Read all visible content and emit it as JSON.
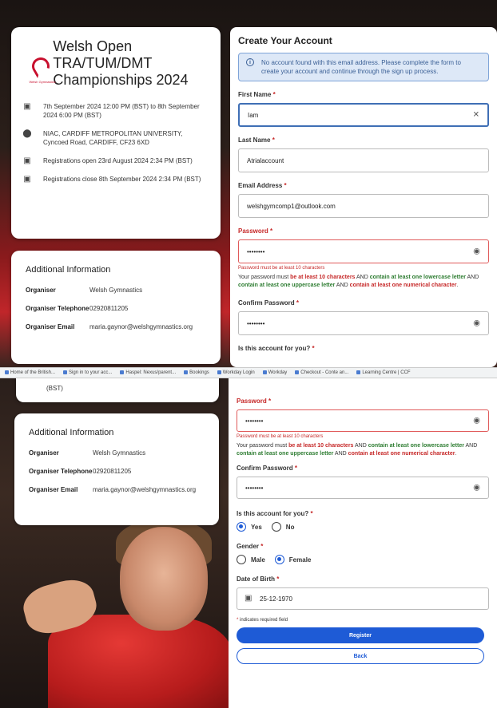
{
  "event": {
    "title": "Welsh Open TRA/TUM/DMT Championships 2024",
    "logo_text": "Welsh Gymnastics",
    "datetime": "7th September 2024 12:00 PM (BST) to 8th September 2024 6:00 PM (BST)",
    "venue": "NIAC, CARDIFF METROPOLITAN UNIVERSITY, Cyncoed Road, CARDIFF, CF23 6XD",
    "reg_open": "Registrations open 23rd August 2024 2:34 PM (BST)",
    "reg_close": "Registrations close 8th September 2024 2:34 PM (BST)",
    "reg_close_tail": "(BST)"
  },
  "additional": {
    "heading": "Additional Information",
    "rows": [
      {
        "key": "Organiser",
        "value": "Welsh Gymnastics"
      },
      {
        "key": "Organiser Telephone",
        "value": "02920811205"
      },
      {
        "key": "Organiser Email",
        "value": "maria.gaynor@welshgymnastics.org"
      }
    ]
  },
  "browser": {
    "bookmarks": [
      "Home of the British...",
      "Sign in to your acc...",
      "Haspel: Nexus/parent...",
      "Bookings",
      "Workday Login",
      "Workday",
      "Checkout - Conte an...",
      "Learning Centre | CCF"
    ]
  },
  "form": {
    "title": "Create Your Account",
    "alert": "No account found with this email address. Please complete the form to create your account and continue through the sign up process.",
    "first_name": {
      "label": "First Name",
      "value": "Iam"
    },
    "last_name": {
      "label": "Last Name",
      "value": "Atrialaccount"
    },
    "email": {
      "label": "Email Address",
      "value": "welshgymcomp1@outlook.com"
    },
    "password": {
      "label": "Password",
      "value": "••••••••",
      "error": "Password must be at least 10 characters"
    },
    "password_hint": {
      "p1": "Your password must ",
      "r1": "be at least 10 characters",
      "p2": " AND ",
      "g1": "contain at least one lowercase letter",
      "p3": " AND ",
      "g2": "contain at least one uppercase letter",
      "p4": " AND ",
      "r2": "contain at least one numerical character",
      "p5": "."
    },
    "confirm_password": {
      "label": "Confirm Password",
      "value": "••••••••"
    },
    "for_you": {
      "label": "Is this account for you?",
      "yes": "Yes",
      "no": "No",
      "selected": "Yes"
    },
    "gender": {
      "label": "Gender",
      "male": "Male",
      "female": "Female",
      "selected": "Female"
    },
    "dob": {
      "label": "Date of Birth",
      "value": "25-12-1970"
    },
    "required_note": "indicates required field",
    "required_mark": "*",
    "register_label": "Register",
    "back_label": "Back"
  }
}
